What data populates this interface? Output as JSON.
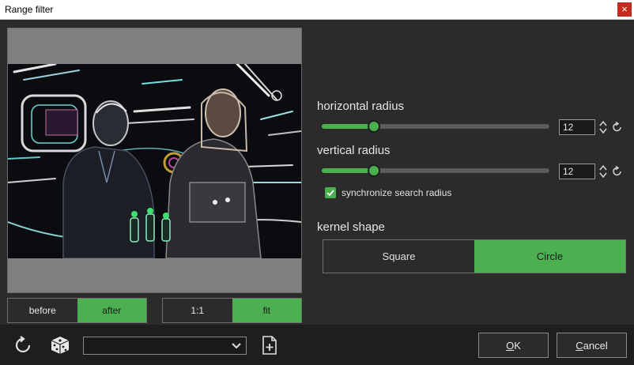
{
  "window": {
    "title": "Range filter",
    "close_glyph": "×"
  },
  "preview": {
    "before_label": "before",
    "after_label": "after",
    "one_to_one_label": "1:1",
    "fit_label": "fit",
    "active_view": "after",
    "active_zoom": "fit"
  },
  "horizontal_radius": {
    "label": "horizontal radius",
    "value": "12",
    "slider_fraction": 0.23
  },
  "vertical_radius": {
    "label": "vertical radius",
    "value": "12",
    "slider_fraction": 0.23
  },
  "sync": {
    "label": "synchronize search radius",
    "checked": true
  },
  "kernel_shape": {
    "label": "kernel shape",
    "options": [
      "Square",
      "Circle"
    ],
    "selected": "Circle"
  },
  "bottom": {
    "dropdown_value": "",
    "ok_label_first": "O",
    "ok_label_rest": "K",
    "cancel_label_first": "C",
    "cancel_label_rest": "ancel"
  },
  "colors": {
    "accent": "#4caf50",
    "background": "#2b2b2b",
    "bottombar": "#1e1e1e"
  },
  "icons": [
    "close-icon",
    "reset-icon",
    "dice-icon",
    "chevron-down-icon",
    "new-preset-icon",
    "spinner-icon",
    "reset-small-icon",
    "check-icon"
  ]
}
